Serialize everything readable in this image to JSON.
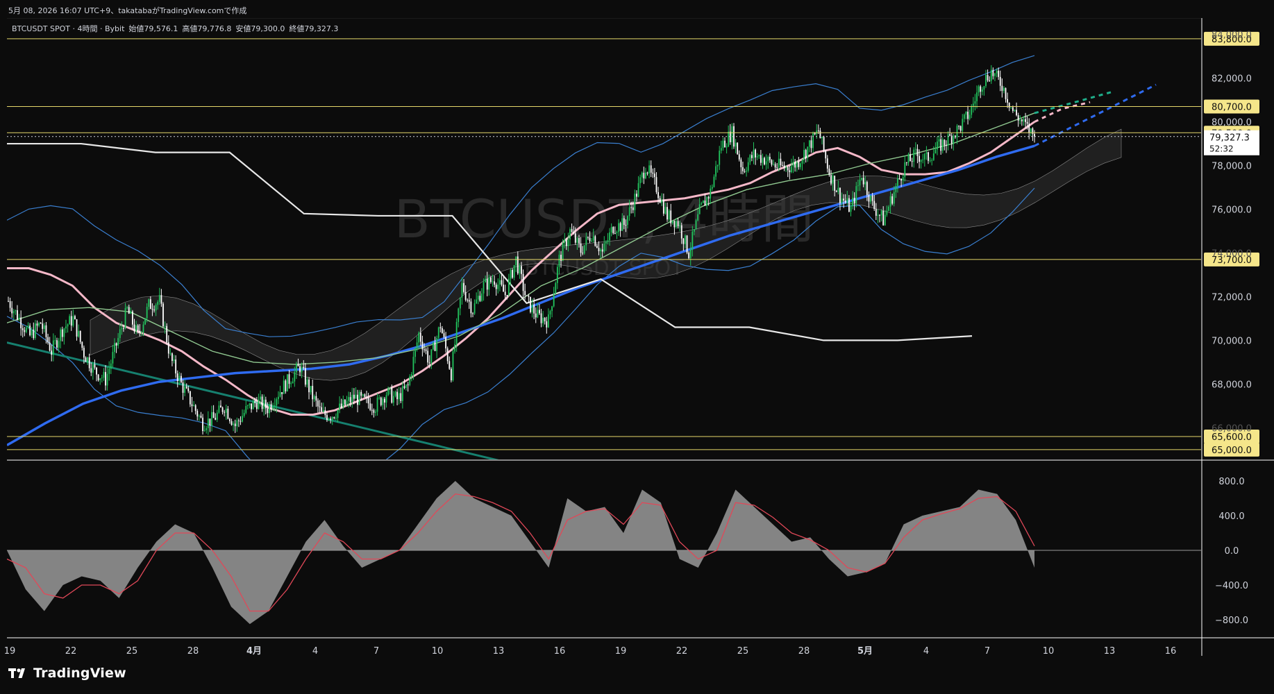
{
  "header": {
    "created": "5月 08, 2026 16:07 UTC+9、takatabaがTradingView.comで作成"
  },
  "legend": {
    "symbol": "BTCUSDT SPOT · 4時間 · Bybit",
    "open_label": "始値",
    "open": "79,576.1",
    "high_label": "高値",
    "high": "79,776.8",
    "low_label": "安値",
    "low": "79,300.0",
    "close_label": "終値",
    "close": "79,327.3"
  },
  "watermark": {
    "main": "BTCUSDT, 4時間",
    "sub": "BTCUSDT SPOT"
  },
  "footer": {
    "brand": "TradingView"
  },
  "colors": {
    "background": "#0c0c0c",
    "up": "#22c55e",
    "down": "#ffffff",
    "level_line": "#e6d86a",
    "ma_pink": "#f5b8c8",
    "ma_blue": "#2f6bf0",
    "ma_green": "#90c890",
    "bollinger": "#3a7fd0",
    "teal_line": "#16806f",
    "cloud": "#3a3a3a",
    "histogram": "#9a9a9a",
    "signal": "#e04858"
  },
  "chart_data": [
    {
      "type": "line",
      "name": "price",
      "y_axis_ticks": [
        66000,
        68000,
        70000,
        72000,
        74000,
        76000,
        78000,
        80000,
        82000,
        84000
      ],
      "ylim": [
        64550,
        84750
      ],
      "x_axis_labels": [
        "19",
        "22",
        "25",
        "28",
        "4月",
        "4",
        "7",
        "10",
        "13",
        "16",
        "19",
        "22",
        "25",
        "28",
        "5月",
        "4",
        "7",
        "10",
        "13",
        "16"
      ],
      "levels": [
        {
          "label": "83,800.0",
          "value": 83800
        },
        {
          "label": "80,700.0",
          "value": 80700
        },
        {
          "label": "79,500.0",
          "value": 79500
        },
        {
          "label": "73,700.0",
          "value": 73700
        },
        {
          "label": "65,600.0",
          "value": 65600
        },
        {
          "label": "65,000.0",
          "value": 65000
        }
      ],
      "last_price": {
        "value": 79327.3,
        "label": "79,327.3",
        "countdown": "52:32"
      },
      "price_path": [
        71800,
        71000,
        70200,
        70800,
        69500,
        70500,
        71000,
        69400,
        68600,
        68200,
        69800,
        71400,
        70200,
        71600,
        71800,
        69200,
        68000,
        67100,
        66200,
        66400,
        67000,
        66100,
        66800,
        67200,
        66900,
        67600,
        68200,
        68800,
        67600,
        66600,
        66600,
        67000,
        67400,
        67200,
        67000,
        67600,
        67300,
        67900,
        70300,
        69000,
        70700,
        68500,
        72500,
        71400,
        72500,
        72800,
        72100,
        73700,
        71800,
        71100,
        70900,
        73700,
        75000,
        74100,
        74900,
        74000,
        75200,
        75300,
        76500,
        78000,
        77000,
        75700,
        75400,
        74000,
        75900,
        76800,
        78900,
        79500,
        77800,
        78500,
        78300,
        78000,
        77900,
        78100,
        78800,
        79600,
        77700,
        76600,
        76000,
        77600,
        76200,
        75500,
        76800,
        78000,
        78500,
        78300,
        78800,
        79200,
        79700,
        80400,
        81700,
        82300,
        81700,
        80500,
        79900,
        79327.3
      ],
      "series": [
        {
          "name": "",
          "color": "pink",
          "values": [
            73300,
            73300,
            73000,
            72500,
            71500,
            70800,
            70400,
            70000,
            69500,
            68800,
            68200,
            67500,
            66900,
            66600,
            66600,
            66800,
            67200,
            67600,
            68000,
            68600,
            69300,
            70100,
            71000,
            72100,
            73200,
            74100,
            75000,
            75800,
            76200,
            76300,
            76400,
            76500,
            76700,
            76900,
            77200,
            77700,
            78100,
            78600,
            78800,
            78400,
            77800,
            77600,
            77600,
            77700,
            78100,
            78600,
            79300,
            80000
          ]
        },
        {
          "name": "",
          "color": "blue",
          "values": [
            65200,
            66200,
            67100,
            67700,
            68100,
            68300,
            68500,
            68600,
            68700,
            68900,
            69300,
            69800,
            70400,
            71000,
            71700,
            72400,
            73000,
            73600,
            74200,
            74800,
            75300,
            75800,
            76300,
            76800,
            77300,
            77800,
            78400,
            78900
          ]
        },
        {
          "name": "",
          "color": "green",
          "values": [
            70800,
            71400,
            71500,
            71300,
            70400,
            69500,
            69000,
            68900,
            69000,
            69200,
            69600,
            70200,
            71200,
            72500,
            73300,
            74300,
            75300,
            76200,
            76900,
            77300,
            77600,
            78100,
            78500,
            79000,
            79700,
            80400
          ]
        },
        {
          "name": "",
          "color": "white",
          "values": [
            79000,
            79000,
            78600,
            78600,
            75800,
            75700,
            75700,
            71700,
            72800,
            70600,
            70600,
            70000,
            70000,
            70200
          ]
        }
      ]
    },
    {
      "type": "area",
      "name": "oscillator",
      "y_axis_ticks": [
        800,
        400,
        0,
        -400,
        -800
      ],
      "y_axis_labels": [
        "800.0",
        "400.0",
        "0.0",
        "−400.0",
        "−800.0"
      ],
      "ylim": [
        -1000,
        1000
      ],
      "values": [
        0,
        -450,
        -700,
        -400,
        -300,
        -350,
        -550,
        -200,
        100,
        300,
        200,
        -200,
        -650,
        -850,
        -700,
        -300,
        100,
        350,
        50,
        -200,
        -100,
        0,
        300,
        600,
        800,
        600,
        500,
        400,
        100,
        -200,
        600,
        450,
        500,
        200,
        700,
        550,
        -100,
        -200,
        200,
        700,
        500,
        300,
        100,
        150,
        -100,
        -300,
        -250,
        -150,
        300,
        400,
        450,
        500,
        700,
        650,
        350,
        -200
      ],
      "signal": [
        -100,
        -200,
        -500,
        -550,
        -400,
        -400,
        -500,
        -350,
        0,
        200,
        200,
        0,
        -300,
        -700,
        -700,
        -450,
        -100,
        200,
        100,
        -100,
        -100,
        0,
        200,
        450,
        650,
        620,
        550,
        450,
        200,
        -100,
        350,
        450,
        480,
        300,
        550,
        520,
        100,
        -100,
        0,
        550,
        520,
        380,
        200,
        120,
        0,
        -200,
        -250,
        -150,
        150,
        350,
        420,
        480,
        600,
        620,
        450,
        50
      ]
    }
  ]
}
